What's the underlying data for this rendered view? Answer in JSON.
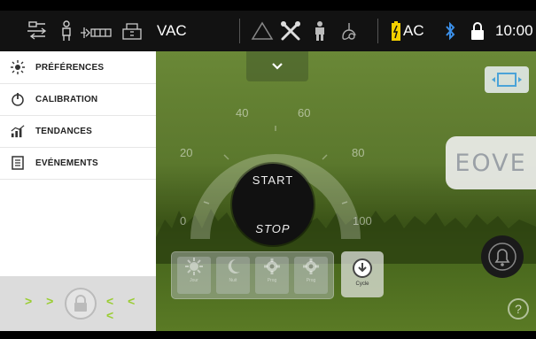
{
  "statusbar": {
    "mode": "VAC",
    "power": "AC",
    "time": "10:00",
    "colors": {
      "battery": "#f5d000",
      "bluetooth": "#3b8fe8"
    },
    "icons": [
      "patient-circuit-icon",
      "patient-icon",
      "accessory-icon",
      "ventilator-icon",
      "alarm-triangle-icon",
      "tools-icon",
      "person-icon",
      "lung-icon",
      "battery-icon",
      "bluetooth-icon",
      "lock-icon"
    ]
  },
  "sidebar": {
    "items": [
      {
        "label": "PRÉFÉRENCES",
        "icon": "sun-settings-icon"
      },
      {
        "label": "CALIBRATION",
        "icon": "power-gauge-icon"
      },
      {
        "label": "TENDANCES",
        "icon": "trend-chart-icon"
      },
      {
        "label": "EVÉNEMENTS",
        "icon": "document-icon"
      }
    ],
    "unlock": {
      "left_arrows": "> > >",
      "right_arrows": "< < <",
      "accent": "#9acd32"
    }
  },
  "dial": {
    "ticks": [
      "0",
      "20",
      "40",
      "60",
      "80",
      "100"
    ],
    "start_label": "START",
    "stop_label": "STOP"
  },
  "brand": {
    "logo": "EOVE"
  },
  "modes": {
    "buttons": [
      {
        "icon": "sun-icon",
        "label": "Jour"
      },
      {
        "icon": "moon-icon",
        "label": "Nuit"
      },
      {
        "icon": "gear-icon",
        "label": "Prog"
      },
      {
        "icon": "gear-icon",
        "label": "Prog"
      }
    ],
    "cycle_label": "Cycle"
  },
  "help": {
    "label": "?"
  }
}
